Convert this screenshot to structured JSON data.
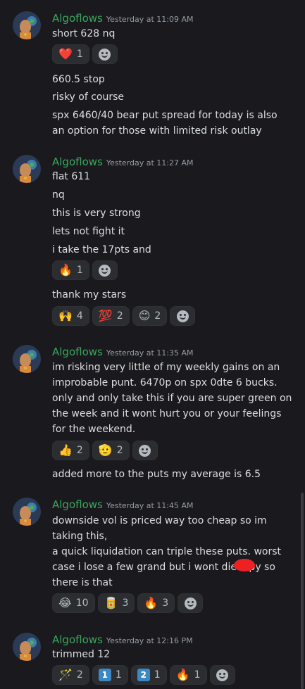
{
  "messages": [
    {
      "username": "Algoflows",
      "timestamp": "Yesterday at 11:09 AM",
      "lines_1": [
        "short 628 nq"
      ],
      "reactions_1": [
        {
          "emoji": "❤️",
          "count": "1",
          "icon": "red-heart-icon"
        }
      ],
      "lines_2": [
        "660.5 stop",
        "risky of course",
        "spx 6460/40 bear put spread for today is also",
        "an option for those with limited risk outlay"
      ]
    },
    {
      "username": "Algoflows",
      "timestamp": "Yesterday at 11:27 AM",
      "lines_1": [
        "flat 611",
        "nq",
        "this is very strong",
        "lets not fight it",
        "i take the 17pts and"
      ],
      "reactions_1": [
        {
          "emoji": "🔥",
          "count": "1",
          "icon": "fire-icon"
        }
      ],
      "lines_2": [
        "thank my stars"
      ],
      "reactions_2": [
        {
          "emoji": "🙌",
          "count": "4",
          "icon": "raised-hands-icon"
        },
        {
          "emoji": "💯",
          "count": "2",
          "icon": "hundred-points-icon"
        },
        {
          "emoji": "😊",
          "count": "2",
          "icon": "smiling-face-icon"
        }
      ]
    },
    {
      "username": "Algoflows",
      "timestamp": "Yesterday at 11:35 AM",
      "lines_1": [
        "im risking very little of my weekly gains on an",
        "improbable punt. 6470p on spx  0dte 6 bucks.",
        "only and only take this if you are super green on",
        "the week and it wont hurt you or your feelings",
        "for the weekend."
      ],
      "reactions_1": [
        {
          "emoji": "👍",
          "count": "2",
          "icon": "thumbs-up-icon"
        },
        {
          "emoji": "🫡",
          "count": "2",
          "icon": "saluting-face-icon"
        }
      ],
      "lines_2": [
        "added more to the puts my average is 6.5"
      ]
    },
    {
      "username": "Algoflows",
      "timestamp": "Yesterday at 11:45 AM",
      "lines_1": [
        "downside vol is priced way too cheap so im",
        "taking this,",
        " a quick liquidation can triple these puts. worst",
        "case i lose a few grand but i wont die a p",
        "there is that"
      ],
      "line_tail": "y so",
      "reactions_1": [
        {
          "emoji": "😂",
          "count": "10",
          "icon": "tears-of-joy-icon"
        },
        {
          "emoji": "🥫",
          "count": "3",
          "icon": "canned-food-icon"
        },
        {
          "emoji": "🔥",
          "count": "3",
          "icon": "fire-icon"
        }
      ]
    },
    {
      "username": "Algoflows",
      "timestamp": "Yesterday at 12:16 PM",
      "lines_1": [
        "trimmed 12"
      ],
      "reactions_1": [
        {
          "emoji": "🪄",
          "count": "2",
          "icon": "magic-wand-icon"
        },
        {
          "emoji": "1",
          "count": "1",
          "icon": "keycap-one-icon",
          "box": true
        },
        {
          "emoji": "2",
          "count": "1",
          "icon": "keycap-two-icon",
          "box": true
        },
        {
          "emoji": "🔥",
          "count": "1",
          "icon": "fire-icon"
        }
      ]
    }
  ]
}
